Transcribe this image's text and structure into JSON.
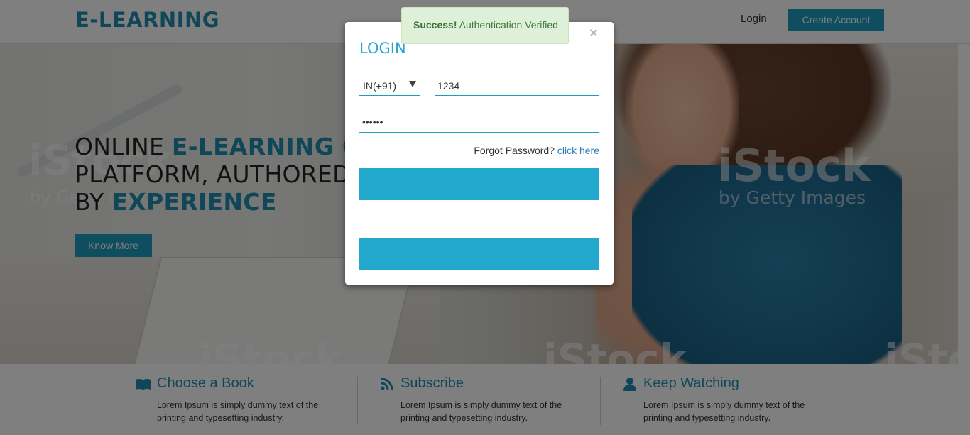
{
  "header": {
    "logo": "E-LEARNING",
    "login_label": "Login",
    "create_account_label": "Create Account"
  },
  "hero": {
    "line1_plain": "ONLINE ",
    "line1_highlight": "E-LEARNING CO",
    "line2_plain": "PLATFORM, AUTHORED",
    "line3_plain": "BY ",
    "line3_highlight": "EXPERIENCE",
    "know_more_label": "Know More",
    "watermark_main": "iStock",
    "watermark_sub": "by Getty Images"
  },
  "features": [
    {
      "icon": "book-icon",
      "title": "Choose a Book",
      "description": "Lorem Ipsum is simply dummy text of the printing and typesetting industry."
    },
    {
      "icon": "rss-icon",
      "title": "Subscribe",
      "description": "Lorem Ipsum is simply dummy text of the printing and typesetting industry."
    },
    {
      "icon": "user-icon",
      "title": "Keep Watching",
      "description": "Lorem Ipsum is simply dummy text of the printing and typesetting industry."
    }
  ],
  "alert": {
    "strong": "Success!",
    "message": "Authentication Verified"
  },
  "login_modal": {
    "title": "LOGIN",
    "close_symbol": "×",
    "country_code": "IN(+91)",
    "phone_value": "1234",
    "password_value": "••••••",
    "forgot_text": "Forgot Password?",
    "forgot_link": "click here"
  },
  "colors": {
    "accent": "#1e9dbf",
    "modal_button": "#22a8cc",
    "alert_bg": "#dff0d8",
    "alert_text": "#3c763d"
  }
}
